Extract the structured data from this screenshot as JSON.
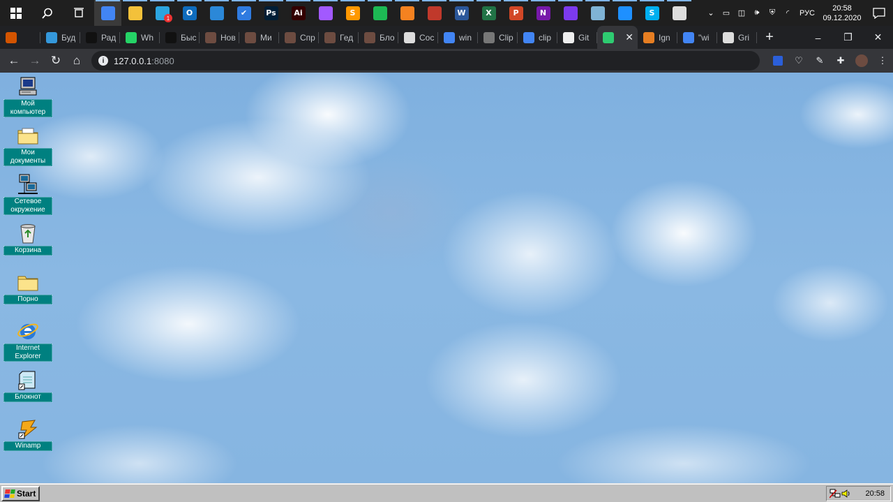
{
  "os_taskbar": {
    "apps": [
      {
        "name": "chrome",
        "color": "#4285f4",
        "glyph": "",
        "active": true
      },
      {
        "name": "file-explorer",
        "color": "#f3c13a",
        "glyph": ""
      },
      {
        "name": "telegram",
        "color": "#2ca5e0",
        "glyph": "",
        "badge": "1"
      },
      {
        "name": "outlook",
        "color": "#0f6cbd",
        "glyph": "O"
      },
      {
        "name": "calendar",
        "color": "#2b88d8",
        "glyph": ""
      },
      {
        "name": "todo",
        "color": "#2f7be0",
        "glyph": "✔"
      },
      {
        "name": "photoshop",
        "color": "#001e36",
        "glyph": "Ps"
      },
      {
        "name": "illustrator",
        "color": "#330000",
        "glyph": "Ai"
      },
      {
        "name": "figma",
        "color": "#a259ff",
        "glyph": ""
      },
      {
        "name": "sublime",
        "color": "#ff9800",
        "glyph": "S"
      },
      {
        "name": "spotify",
        "color": "#1db954",
        "glyph": ""
      },
      {
        "name": "fl-studio",
        "color": "#f58220",
        "glyph": ""
      },
      {
        "name": "snipping",
        "color": "#c0392b",
        "glyph": ""
      },
      {
        "name": "word",
        "color": "#2b579a",
        "glyph": "W"
      },
      {
        "name": "excel",
        "color": "#217346",
        "glyph": "X"
      },
      {
        "name": "powerpoint",
        "color": "#d24726",
        "glyph": "P"
      },
      {
        "name": "onenote",
        "color": "#7719aa",
        "glyph": "N"
      },
      {
        "name": "obsidian",
        "color": "#7c3aed",
        "glyph": ""
      },
      {
        "name": "virtualbox",
        "color": "#7fb3d5",
        "glyph": ""
      },
      {
        "name": "phone",
        "color": "#1e90ff",
        "glyph": ""
      },
      {
        "name": "skype",
        "color": "#00aff0",
        "glyph": "S"
      },
      {
        "name": "window-app",
        "color": "#dddddd",
        "glyph": ""
      }
    ],
    "lang": "РУС",
    "time": "20:58",
    "date": "09.12.2020"
  },
  "browser": {
    "tabs": [
      {
        "label": "",
        "color": "#d35400"
      },
      {
        "label": "Буд",
        "color": "#3498db"
      },
      {
        "label": "Рад",
        "color": "#111111"
      },
      {
        "label": "Wh",
        "color": "#25d366"
      },
      {
        "label": "Быс",
        "color": "#111111"
      },
      {
        "label": "Нов",
        "color": "#6d4c41"
      },
      {
        "label": "Ми",
        "color": "#6d4c41"
      },
      {
        "label": "Спр",
        "color": "#6d4c41"
      },
      {
        "label": "Гед",
        "color": "#6d4c41"
      },
      {
        "label": "Бло",
        "color": "#6d4c41"
      },
      {
        "label": "Coc",
        "color": "#dddddd"
      },
      {
        "label": "win",
        "color": "#4285f4"
      },
      {
        "label": "Clip",
        "color": "#777777"
      },
      {
        "label": "clip",
        "color": "#4285f4"
      },
      {
        "label": "Git",
        "color": "#eeeeee"
      },
      {
        "label": "",
        "color": "#2ecc71",
        "active": true
      },
      {
        "label": "Ign",
        "color": "#e67e22"
      },
      {
        "label": "\"wi",
        "color": "#4285f4"
      },
      {
        "label": "Gri",
        "color": "#dddddd"
      }
    ],
    "url_host": "127.0.0.1",
    "url_port": ":8080"
  },
  "desktop": {
    "icons": [
      {
        "label": "Мой компьютер",
        "icon": "computer-icon"
      },
      {
        "label": "Мои документы",
        "icon": "folder-documents-icon"
      },
      {
        "label": "Сетевое окружение",
        "icon": "network-icon"
      },
      {
        "label": "Корзина",
        "icon": "recycle-bin-icon"
      },
      {
        "label": "Порно",
        "icon": "folder-icon"
      },
      {
        "label": "Internet Explorer",
        "icon": "ie-icon"
      },
      {
        "label": "Блокнот",
        "icon": "notepad-icon"
      },
      {
        "label": "Winamp",
        "icon": "winamp-icon"
      }
    ]
  },
  "win98_taskbar": {
    "start_label": "Start",
    "clock": "20:58"
  }
}
